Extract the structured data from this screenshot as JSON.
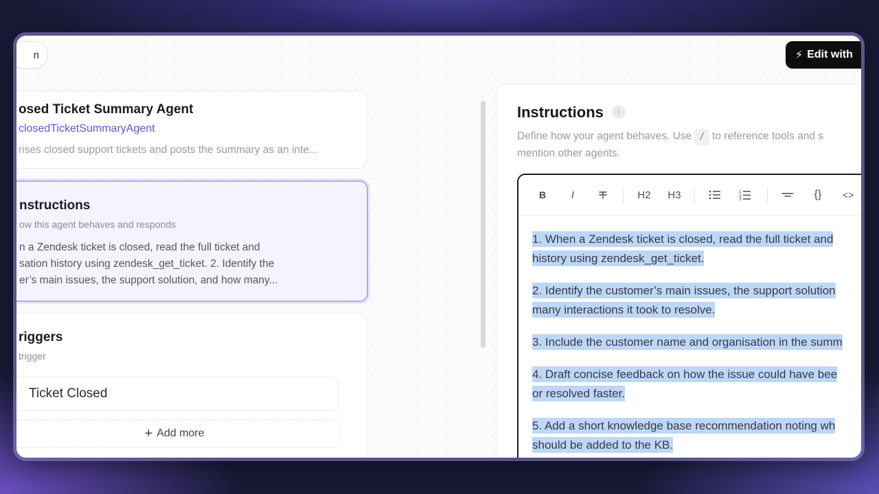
{
  "header": {
    "left_button_label": "n",
    "edit_button_label": "Edit with",
    "edit_button_icon": "lightning-icon"
  },
  "agent_card": {
    "title": "osed Ticket Summary Agent",
    "handle": "closedTicketSummaryAgent",
    "description": "rises closed support tickets and posts the summary as an inte..."
  },
  "instructions_card": {
    "title": "nstructions",
    "subtitle": "ow this agent behaves and responds",
    "preview_lines": [
      "n a Zendesk ticket is closed, read the full ticket and",
      "sation history using zendesk_get_ticket. 2. Identify the",
      "er’s main issues, the support solution, and how many..."
    ]
  },
  "triggers_card": {
    "title": "riggers",
    "subtitle": "trigger",
    "trigger_item": "Ticket Closed",
    "add_more_label": "Add more"
  },
  "instructions_panel": {
    "title": "Instructions",
    "info_icon": "i",
    "description_before_key": "Define how your agent behaves. Use",
    "slash_key": "/",
    "description_after_key": "to reference tools and s",
    "description_line2": "mention other agents."
  },
  "toolbar": {
    "bold": "B",
    "italic": "I",
    "h2": "H2",
    "h3": "H3",
    "code_block": "{}",
    "inline_code": "<>"
  },
  "editor": {
    "paragraphs": [
      {
        "lines": [
          "1. When a Zendesk ticket is closed, read the full ticket and",
          "history using zendesk_get_ticket."
        ]
      },
      {
        "lines": [
          "2. Identify the customer’s main issues, the support solution",
          "many interactions it took to resolve."
        ]
      },
      {
        "lines": [
          "3. Include the customer name and organisation in the summ"
        ]
      },
      {
        "lines": [
          "4. Draft concise feedback on how the issue could have bee",
          "or resolved faster."
        ]
      },
      {
        "lines": [
          "5. Add a short knowledge base recommendation noting wh",
          "should be added to the KB."
        ]
      }
    ]
  },
  "colors": {
    "accent": "#6b4fd6",
    "selection": "#bdd7f7",
    "selected_card_border": "#b9a6ef"
  }
}
